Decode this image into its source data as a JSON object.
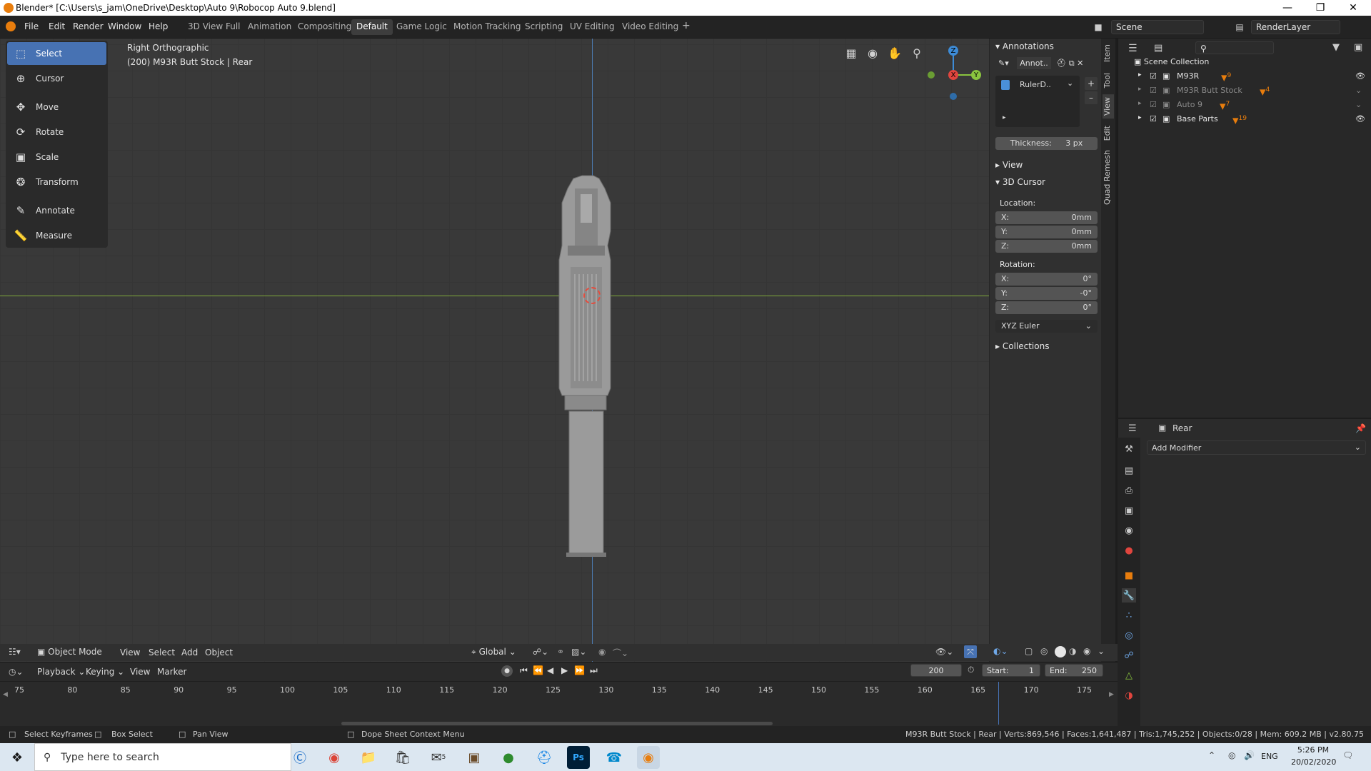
{
  "window": {
    "title": "Blender* [C:\\Users\\s_jam\\OneDrive\\Desktop\\Auto 9\\Robocop Auto 9.blend]"
  },
  "menu": [
    "File",
    "Edit",
    "Render",
    "Window",
    "Help"
  ],
  "workspaces": [
    "3D View Full",
    "Animation",
    "Compositing",
    "Default",
    "Game Logic",
    "Motion Tracking",
    "Scripting",
    "UV Editing",
    "Video Editing"
  ],
  "active_workspace": "Default",
  "scene": {
    "label": "Scene",
    "render_layer": "RenderLayer"
  },
  "tools": [
    "Select",
    "Cursor",
    "Move",
    "Rotate",
    "Scale",
    "Transform",
    "Annotate",
    "Measure"
  ],
  "viewport": {
    "view_name": "Right Orthographic",
    "object_info": "(200) M93R Butt Stock | Rear"
  },
  "gizmo": {
    "z": "Z",
    "x": "X",
    "y": "Y"
  },
  "npanel": {
    "annotations_title": "Annotations",
    "annot_name": "Annot..",
    "layer_name": "RulerD..",
    "thickness_label": "Thickness:",
    "thickness_value": "3 px",
    "view_title": "View",
    "cursor_title": "3D Cursor",
    "location_label": "Location:",
    "loc_x_label": "X:",
    "loc_x": "0mm",
    "loc_y_label": "Y:",
    "loc_y": "0mm",
    "loc_z_label": "Z:",
    "loc_z": "0mm",
    "rotation_label": "Rotation:",
    "rot_x_label": "X:",
    "rot_x": "0°",
    "rot_y_label": "Y:",
    "rot_y": "-0°",
    "rot_z_label": "Z:",
    "rot_z": "0°",
    "rotation_mode": "XYZ Euler",
    "collections_title": "Collections"
  },
  "side_tabs": [
    "Item",
    "Tool",
    "View",
    "Edit",
    "Quad Remesh"
  ],
  "outliner": {
    "root": "Scene Collection",
    "items": [
      {
        "name": "M93R",
        "badge": "9"
      },
      {
        "name": "M93R Butt Stock",
        "badge": "4"
      },
      {
        "name": "Auto 9",
        "badge": "7"
      },
      {
        "name": "Base Parts",
        "badge": "19"
      }
    ]
  },
  "properties": {
    "object_name": "Rear",
    "add_modifier": "Add Modifier"
  },
  "viewport_header": {
    "mode": "Object Mode",
    "menus": [
      "View",
      "Select",
      "Add",
      "Object"
    ],
    "orientation": "Global"
  },
  "timeline": {
    "menus": [
      "Playback",
      "Keying",
      "View",
      "Marker"
    ],
    "current_frame": "200",
    "start_label": "Start:",
    "start": "1",
    "end_label": "End:",
    "end": "250",
    "ticks": [
      "75",
      "80",
      "85",
      "90",
      "95",
      "100",
      "105",
      "110",
      "115",
      "120",
      "125",
      "130",
      "135",
      "140",
      "145",
      "150",
      "155",
      "160",
      "165",
      "170",
      "175"
    ]
  },
  "status": {
    "hint1": "Select Keyframes",
    "hint2": "Box Select",
    "hint3": "Pan View",
    "hint4": "Dope Sheet Context Menu",
    "stats": "M93R Butt Stock | Rear | Verts:869,546 | Faces:1,641,487 | Tris:1,745,252 | Objects:0/28 | Mem: 609.2 MB | v2.80.75"
  },
  "taskbar": {
    "search": "Type here to search",
    "lang": "ENG",
    "time": "5:26 PM",
    "date": "20/02/2020",
    "mail_badge": "5"
  },
  "colors": {
    "accent": "#4772b3",
    "blender_orange": "#e87d0d",
    "axis_x": "#e0453e",
    "axis_y": "#8ac43f",
    "axis_z": "#3d8bd6"
  }
}
